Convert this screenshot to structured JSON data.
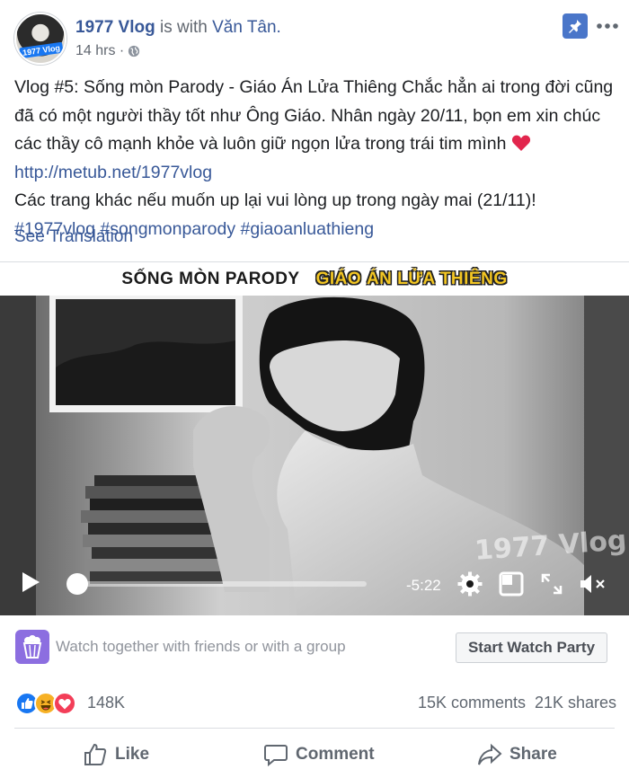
{
  "post": {
    "page_name": "1977 Vlog",
    "with_text": "is with",
    "friend_name": "Văn Tân.",
    "avatar_logo": "1977 Vlog",
    "time_ago": "14 hrs ·",
    "privacy_icon": "globe-icon",
    "pin_icon": "pin-icon",
    "more_icon": "more-horizontal-icon"
  },
  "text": {
    "line1": "Vlog #5: Sống mòn Parody - Giáo Án Lửa Thiêng Chắc hẳn ai trong đời cũng",
    "line2": "đã có một người thầy tốt như Ông Giáo. Nhân ngày 20/11, bọn em xin chúc",
    "line3": "các thầy cô mạnh khỏe và luôn giữ ngọn lửa trong trái tim mình",
    "heart_emoji": "❤️",
    "link": "http://metub.net/1977vlog",
    "line5": "Các trang khác nếu muốn up lại vui lòng up trong ngày mai (21/11)!",
    "hashtags": "#1977vlog #songmonparody #giaoanluathieng",
    "see_translation": "See Translation"
  },
  "video": {
    "title_left": "SỐNG MÒN PARODY",
    "title_right": "GIÁO ÁN LỬA THIÊNG",
    "watermark": "1977 Vlog",
    "progress": 0.02,
    "time_remaining": "-5:22",
    "icons": [
      "play-icon",
      "gear-icon",
      "picture-in-picture-icon",
      "fullscreen-icon",
      "mute-icon"
    ]
  },
  "watch_party": {
    "icon": "popcorn-icon",
    "prompt": "Watch together with friends or with a group",
    "button": "Start Watch Party"
  },
  "stats": {
    "reactions": [
      "like",
      "haha",
      "love"
    ],
    "reaction_count": "148K",
    "comments": "15K comments",
    "shares": "21K shares"
  },
  "actions": {
    "like": "Like",
    "comment": "Comment",
    "share": "Share"
  },
  "colors": {
    "link": "#385898",
    "accent_blue": "#1877f2",
    "watch_party_purple": "#8c6ee0",
    "video_title_yellow": "#f3c623"
  }
}
